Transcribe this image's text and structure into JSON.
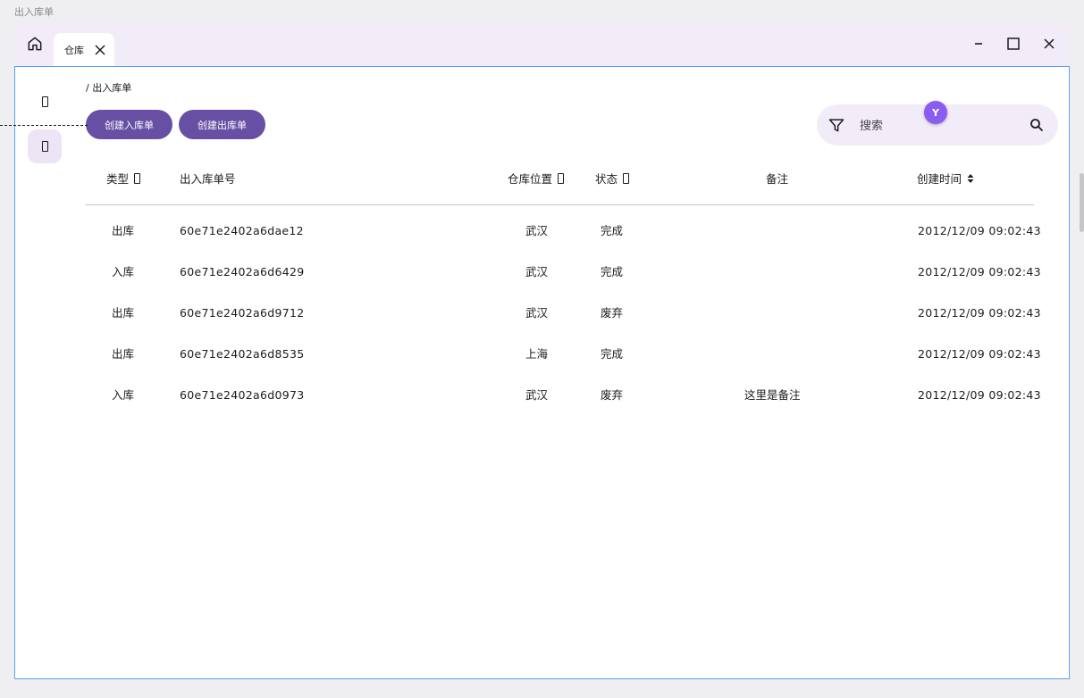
{
  "window": {
    "title": "出入库单"
  },
  "tabs": [
    {
      "label": "仓库"
    }
  ],
  "icons": {
    "home": "home-icon",
    "close": "close-icon",
    "minimize": "minimize-icon",
    "maximize": "maximize-icon",
    "filter": "filter-icon",
    "search": "search-icon",
    "sort": "sort-icon"
  },
  "breadcrumb": "/ 出入库单",
  "actions": {
    "create_in": "创建入库单",
    "create_out": "创建出库单"
  },
  "search": {
    "placeholder": "搜索"
  },
  "avatar": {
    "initial": "Y"
  },
  "table": {
    "columns": [
      "类型",
      "出入库单号",
      "仓库位置",
      "状态",
      "备注",
      "创建时间"
    ],
    "rows": [
      {
        "type": "出库",
        "id": "60e71e2402a6dae12",
        "location": "武汉",
        "status": "完成",
        "note": "",
        "created": "2012/12/09 09:02:43"
      },
      {
        "type": "入库",
        "id": "60e71e2402a6d6429",
        "location": "武汉",
        "status": "完成",
        "note": "",
        "created": "2012/12/09 09:02:43"
      },
      {
        "type": "出库",
        "id": "60e71e2402a6d9712",
        "location": "武汉",
        "status": "废弃",
        "note": "",
        "created": "2012/12/09 09:02:43"
      },
      {
        "type": "出库",
        "id": "60e71e2402a6d8535",
        "location": "上海",
        "status": "完成",
        "note": "",
        "created": "2012/12/09 09:02:43"
      },
      {
        "type": "入库",
        "id": "60e71e2402a6d0973",
        "location": "武汉",
        "status": "废弃",
        "note": "这里是备注",
        "created": "2012/12/09 09:02:43"
      }
    ]
  },
  "colors": {
    "primary": "#6750a4",
    "tab_bar": "#f1ecf7",
    "focus_border": "#5aa2ec",
    "avatar": "#8a5cf0"
  }
}
